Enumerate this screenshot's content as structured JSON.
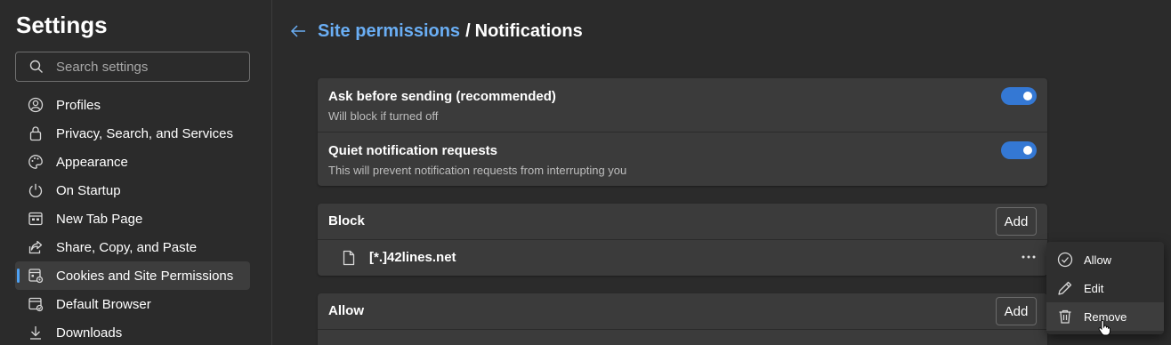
{
  "sidebar": {
    "title": "Settings",
    "search_placeholder": "Search settings",
    "items": [
      {
        "label": "Profiles",
        "icon": "profile-icon"
      },
      {
        "label": "Privacy, Search, and Services",
        "icon": "lock-icon"
      },
      {
        "label": "Appearance",
        "icon": "palette-icon"
      },
      {
        "label": "On Startup",
        "icon": "power-icon"
      },
      {
        "label": "New Tab Page",
        "icon": "new-tab-icon"
      },
      {
        "label": "Share, Copy, and Paste",
        "icon": "share-icon"
      },
      {
        "label": "Cookies and Site Permissions",
        "icon": "cookie-permissions-icon",
        "active": true
      },
      {
        "label": "Default Browser",
        "icon": "browser-icon"
      },
      {
        "label": "Downloads",
        "icon": "download-icon"
      }
    ]
  },
  "header": {
    "parent": "Site permissions",
    "separator": "/",
    "current": "Notifications"
  },
  "settings": [
    {
      "title": "Ask before sending (recommended)",
      "description": "Will block if turned off",
      "enabled": true
    },
    {
      "title": "Quiet notification requests",
      "description": "This will prevent notification requests from interrupting you",
      "enabled": true
    }
  ],
  "block": {
    "title": "Block",
    "add_label": "Add",
    "sites": [
      "[*.]42lines.net"
    ]
  },
  "allow": {
    "title": "Allow",
    "add_label": "Add"
  },
  "context_menu": {
    "items": [
      {
        "label": "Allow",
        "icon": "check-circle-icon"
      },
      {
        "label": "Edit",
        "icon": "pencil-icon"
      },
      {
        "label": "Remove",
        "icon": "trash-icon",
        "hover": true
      }
    ]
  },
  "colors": {
    "accent": "#6aaef4",
    "toggle_on": "#3478d4",
    "background": "#2b2b2b",
    "card": "#3b3b3b"
  }
}
